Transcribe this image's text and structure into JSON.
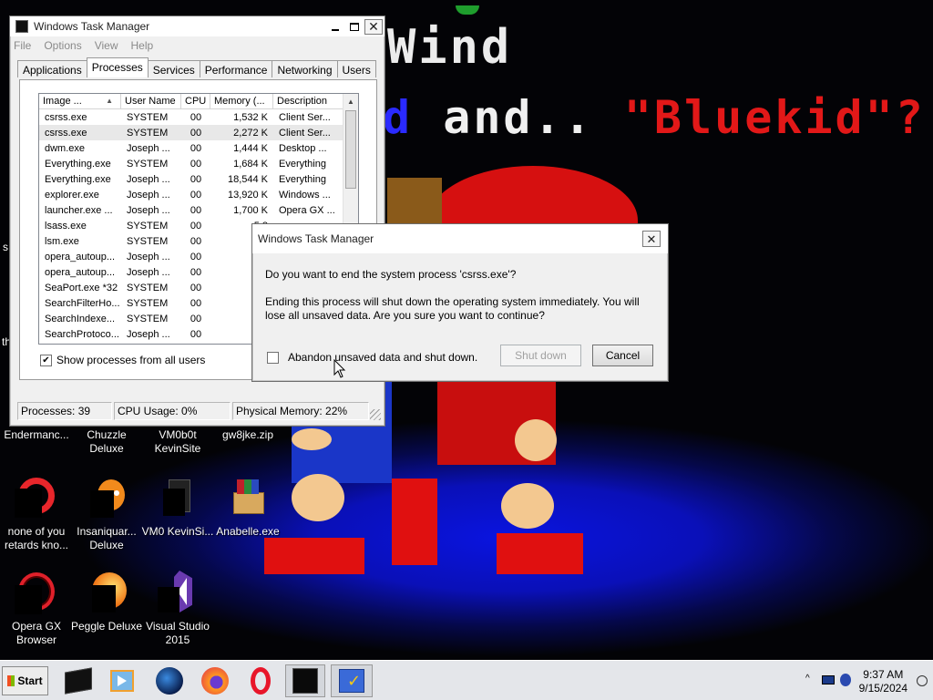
{
  "wallpaper": {
    "top_text": "Wind",
    "mid_text_blue": "d",
    "mid_text_white": " and.. ",
    "mid_text_red": "\"Bluekid\"?",
    "colors": {
      "bg": "#030306",
      "blue_floor": "#0a14e0",
      "red": "#e21818"
    }
  },
  "desktop_icons": [
    {
      "label": "Endermanc...",
      "icon": "app-icon"
    },
    {
      "label": "Chuzzle Deluxe",
      "icon": "app-icon"
    },
    {
      "label": "VM0b0t KevinSite",
      "icon": "app-icon"
    },
    {
      "label": "gw8jke.zip",
      "icon": "zip-icon"
    },
    {
      "label": "none of you retards kno...",
      "icon": "opera-icon"
    },
    {
      "label": "Insaniquar... Deluxe",
      "icon": "fish-icon"
    },
    {
      "label": "VM0 KevinSi...",
      "icon": "file-icon"
    },
    {
      "label": "Anabelle.exe",
      "icon": "winrar-icon"
    },
    {
      "label": "Opera GX Browser",
      "icon": "opera-gx-icon"
    },
    {
      "label": "Peggle Deluxe",
      "icon": "peggle-icon"
    },
    {
      "label": "Visual Studio 2015",
      "icon": "visual-studio-icon"
    }
  ],
  "desktop_edge_labels": {
    "s1": "s",
    "s2": "th"
  },
  "taskmgr": {
    "title": "Windows Task Manager",
    "menu": [
      "File",
      "Options",
      "View",
      "Help"
    ],
    "tabs": [
      "Applications",
      "Processes",
      "Services",
      "Performance",
      "Networking",
      "Users"
    ],
    "active_tab": "Processes",
    "columns": [
      "Image ...",
      "User Name",
      "CPU",
      "Memory (...",
      "Description"
    ],
    "rows": [
      [
        "csrss.exe",
        "SYSTEM",
        "00",
        "1,532 K",
        "Client Ser..."
      ],
      [
        "csrss.exe",
        "SYSTEM",
        "00",
        "2,272 K",
        "Client Ser..."
      ],
      [
        "dwm.exe",
        "Joseph ...",
        "00",
        "1,444 K",
        "Desktop ..."
      ],
      [
        "Everything.exe",
        "SYSTEM",
        "00",
        "1,684 K",
        "Everything"
      ],
      [
        "Everything.exe",
        "Joseph ...",
        "00",
        "18,544 K",
        "Everything"
      ],
      [
        "explorer.exe",
        "Joseph ...",
        "00",
        "13,920 K",
        "Windows ..."
      ],
      [
        "launcher.exe ...",
        "Joseph ...",
        "00",
        "1,700 K",
        "Opera GX ..."
      ],
      [
        "lsass.exe",
        "SYSTEM",
        "00",
        "5,8",
        ""
      ],
      [
        "lsm.exe",
        "SYSTEM",
        "00",
        "1,6",
        ""
      ],
      [
        "opera_autoup...",
        "Joseph ...",
        "00",
        "1,7",
        ""
      ],
      [
        "opera_autoup...",
        "Joseph ...",
        "00",
        "1,8",
        ""
      ],
      [
        "SeaPort.exe *32",
        "SYSTEM",
        "00",
        "5,1",
        ""
      ],
      [
        "SearchFilterHo...",
        "SYSTEM",
        "00",
        "1,9",
        ""
      ],
      [
        "SearchIndexe...",
        "SYSTEM",
        "00",
        "3,9",
        ""
      ],
      [
        "SearchProtoco...",
        "Joseph ...",
        "00",
        "1,9",
        ""
      ],
      [
        "services.exe",
        "SYSTEM",
        "00",
        "3,4",
        ""
      ]
    ],
    "show_all_label": "Show processes from all users",
    "show_all_checked": "✔",
    "status": {
      "processes": "Processes: 39",
      "cpu": "CPU Usage: 0%",
      "memory": "Physical Memory: 22%"
    }
  },
  "dialog": {
    "title": "Windows Task Manager",
    "question": "Do you want to end the system process 'csrss.exe'?",
    "warning": "Ending this process will shut down the operating system immediately.  You will lose all unsaved data.  Are you sure you want to continue?",
    "checkbox_label": "Abandon unsaved data and shut down.",
    "shutdown_label": "Shut down",
    "cancel_label": "Cancel"
  },
  "taskbar": {
    "start_label": "Start",
    "apps": [
      "black-app-icon",
      "media-player-icon",
      "globe-icon",
      "firefox-icon",
      "opera-icon",
      "task-manager-icon",
      "checklist-icon"
    ],
    "time": "9:37 AM",
    "date": "9/15/2024"
  }
}
